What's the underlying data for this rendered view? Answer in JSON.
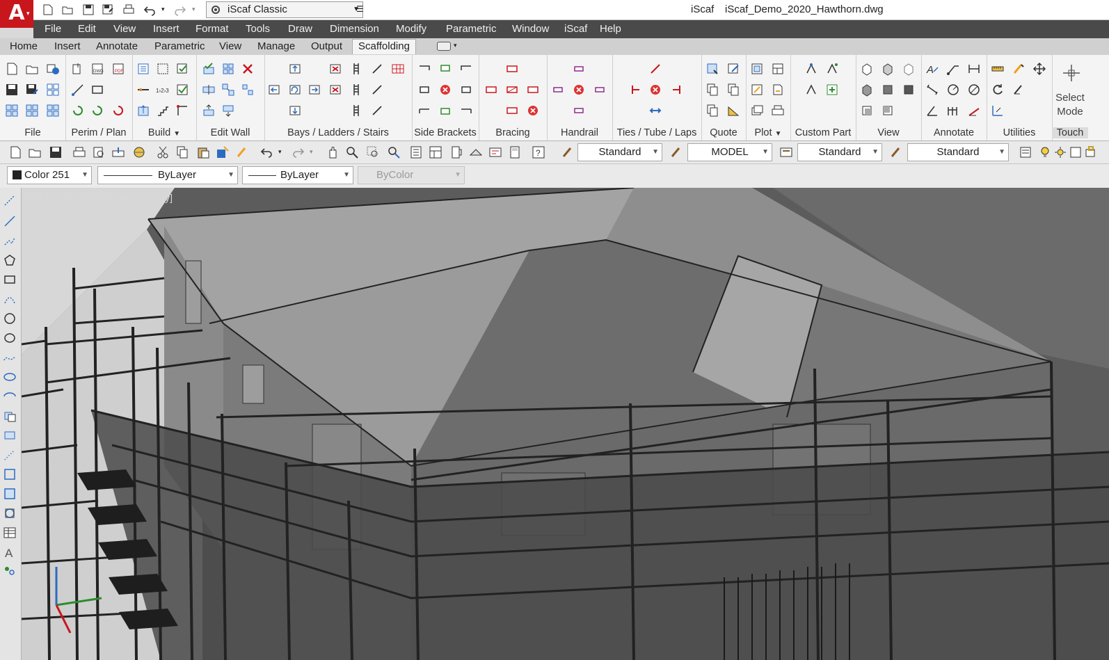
{
  "window": {
    "app_name": "iScaf",
    "file_name": "iScaf_Demo_2020_Hawthorn.dwg",
    "workspace": "iScaf Classic",
    "logo_letter": "A"
  },
  "quick_access": [
    "new-icon",
    "open-icon",
    "save-icon",
    "save-as-icon",
    "print-icon",
    "undo-icon",
    "redo-icon"
  ],
  "menu": [
    "File",
    "Edit",
    "View",
    "Insert",
    "Format",
    "Tools",
    "Draw",
    "Dimension",
    "Modify",
    "Parametric",
    "Window",
    "iScaf",
    "Help"
  ],
  "tabs": [
    "Home",
    "Insert",
    "Annotate",
    "Parametric",
    "View",
    "Manage",
    "Output",
    "Scaffolding"
  ],
  "active_tab": "Scaffolding",
  "panels": {
    "file": "File",
    "perim": "Perim / Plan",
    "build": "Build",
    "editwall": "Edit Wall",
    "bays": "Bays /  Ladders / Stairs",
    "sidebrackets": "Side Brackets",
    "bracing": "Bracing",
    "handrail": "Handrail",
    "ties": "Ties / Tube / Laps",
    "quote": "Quote",
    "plot": "Plot",
    "custompart": "Custom Part",
    "view": "View",
    "annotate": "Annotate",
    "utilities": "Utilities",
    "touch": "Touch",
    "select_mode_1": "Select",
    "select_mode_2": "Mode"
  },
  "toolbar": {
    "text_style": "Standard",
    "layout": "MODEL",
    "dim_style": "Standard",
    "table_style": "Standard"
  },
  "properties": {
    "color": "Color 251",
    "linetype": "ByLayer",
    "lineweight": "ByLayer",
    "plotstyle": "ByColor"
  },
  "viewport": {
    "label": "[−][Custom View][Shades of Gray]"
  },
  "colors": {
    "brand": "#c8161d",
    "menubar": "#4a4a4a",
    "viewport_bg": "#5c5c5c",
    "roof": "#9a9a9a",
    "scaffold": "#2a2a2a"
  }
}
